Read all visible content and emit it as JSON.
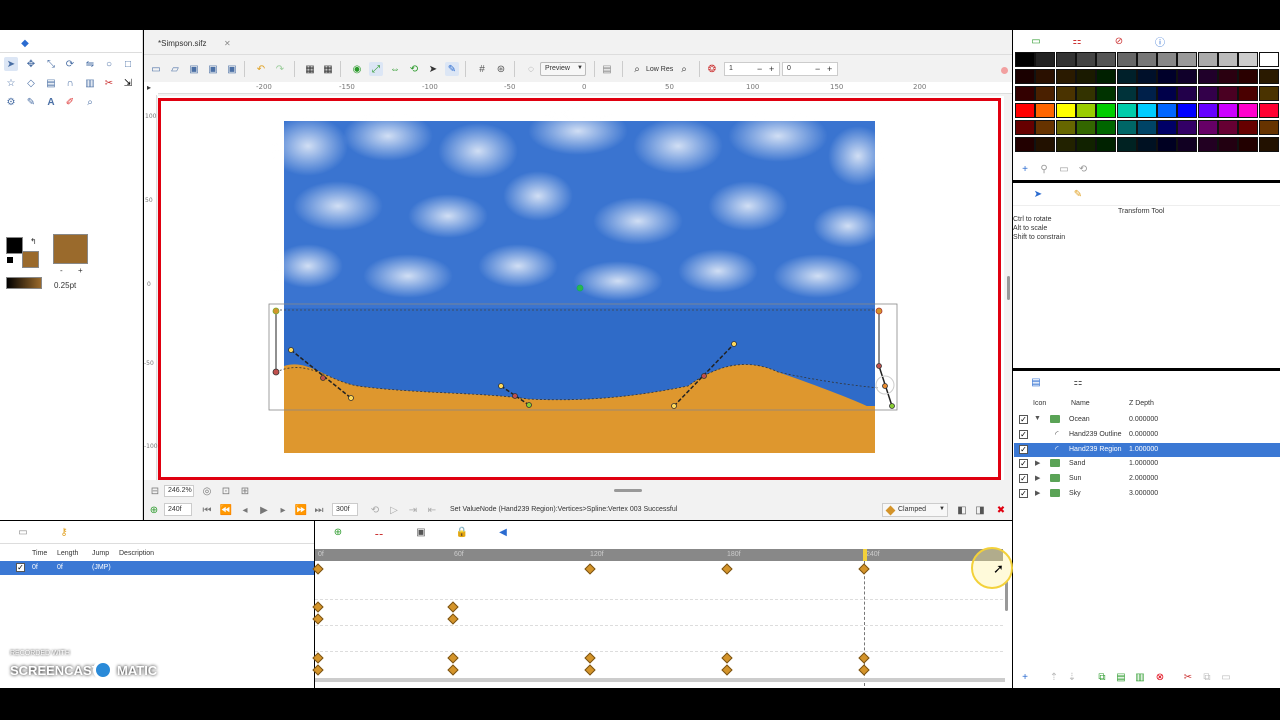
{
  "document": {
    "tab_title": "*Simpson.sifz",
    "close": "✕"
  },
  "toolbar": {
    "preview_label": "Preview",
    "lowres_label": "Low Res",
    "field1": "1",
    "field2": "0"
  },
  "rulers": {
    "top": [
      "-200",
      "-150",
      "-100",
      "-50",
      "0",
      "50",
      "100",
      "150",
      "200"
    ],
    "left": [
      "100",
      "50",
      "0",
      "-50",
      "-100"
    ]
  },
  "toolbox": {
    "outline_width": "0.25pt",
    "colors": {
      "outline": "#000000",
      "fill": "#9a6a2c"
    }
  },
  "canvas_bottom": {
    "zoom": "246.2%",
    "current_time": "240f",
    "end_time": "300f",
    "status": "Set ValueNode (Hand239 Region):Vertices>Spline:Vertex 003 Successful",
    "interpolation": "Clamped"
  },
  "keyframes_panel": {
    "headers": {
      "time": "Time",
      "length": "Length",
      "jump": "Jump",
      "description": "Description"
    },
    "rows": [
      {
        "time": "0f",
        "length": "0f",
        "jump": "(JMP)",
        "description": ""
      }
    ]
  },
  "timetrack": {
    "ticks": [
      "0f",
      "60f",
      "120f",
      "180f",
      "240f"
    ]
  },
  "palette": {
    "colors": [
      [
        "#000000",
        "#222222",
        "#333333",
        "#444444",
        "#555555",
        "#666666",
        "#777777",
        "#888888",
        "#999999",
        "#aaaaaa",
        "#bbbbbb",
        "#cccccc",
        "#ffffff"
      ],
      [
        "#1a0000",
        "#2a1000",
        "#2a1a00",
        "#1a1a00",
        "#002000",
        "#00202a",
        "#00102a",
        "#00002a",
        "#10002a",
        "#20002a",
        "#2a0010",
        "#2a0000",
        "#2a1a00"
      ],
      [
        "#330000",
        "#4a2000",
        "#4a3300",
        "#333300",
        "#003300",
        "#00333a",
        "#00204a",
        "#00004a",
        "#22004a",
        "#33004a",
        "#4a0022",
        "#4a0000",
        "#4a3300"
      ],
      [
        "#ff0000",
        "#ff6600",
        "#ffff00",
        "#99cc00",
        "#00cc00",
        "#00ccaa",
        "#00ccff",
        "#0066ff",
        "#0000ff",
        "#6600ff",
        "#cc00ff",
        "#ff00cc",
        "#ff0033"
      ],
      [
        "#660000",
        "#663300",
        "#666600",
        "#336600",
        "#006600",
        "#006666",
        "#004466",
        "#000066",
        "#330066",
        "#660066",
        "#660033",
        "#660000",
        "#663300"
      ],
      [
        "#220000",
        "#221100",
        "#222200",
        "#112200",
        "#002200",
        "#002222",
        "#001122",
        "#000022",
        "#110022",
        "#220022",
        "#220011",
        "#220000",
        "#221100"
      ]
    ]
  },
  "params": {
    "tool_name": "Transform Tool",
    "hints": [
      "Ctrl to rotate",
      "Alt to scale",
      "Shift to constrain"
    ]
  },
  "layers": {
    "headers": {
      "icon": "Icon",
      "name": "Name",
      "zdepth": "Z Depth"
    },
    "rows": [
      {
        "name": "Ocean",
        "z": "0.000000",
        "indent": 0,
        "expanded": true,
        "selected": false
      },
      {
        "name": "Hand239 Outline",
        "z": "0.000000",
        "indent": 1,
        "expanded": false,
        "selected": false
      },
      {
        "name": "Hand239 Region",
        "z": "1.000000",
        "indent": 1,
        "expanded": false,
        "selected": true
      },
      {
        "name": "Sand",
        "z": "1.000000",
        "indent": 0,
        "expanded": false,
        "selected": false
      },
      {
        "name": "Sun",
        "z": "2.000000",
        "indent": 0,
        "expanded": false,
        "selected": false
      },
      {
        "name": "Sky",
        "z": "3.000000",
        "indent": 0,
        "expanded": false,
        "selected": false
      }
    ]
  },
  "watermark": {
    "line1": "RECORDED WITH",
    "line2": "SCREENCAST",
    "line3": "MATIC"
  }
}
